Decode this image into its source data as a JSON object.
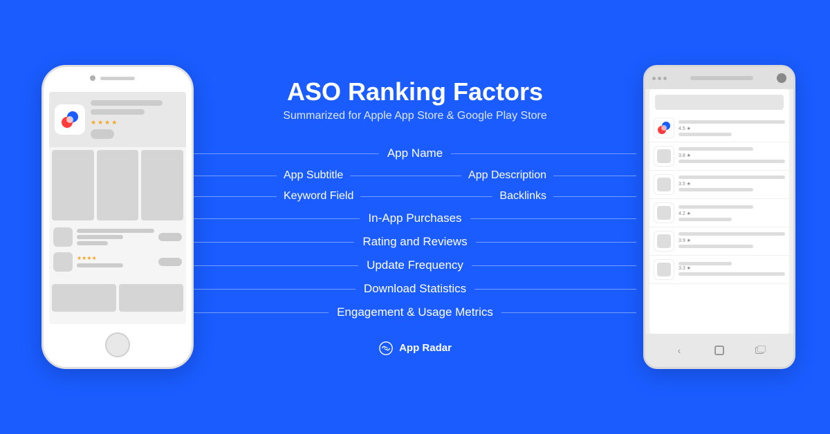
{
  "title": "ASO Ranking Factors",
  "subtitle": "Summarized for Apple App Store & Google Play Store",
  "factors": {
    "app_name": "App Name",
    "app_subtitle": "App Subtitle",
    "keyword_field": "Keyword Field",
    "app_description": "App Description",
    "backlinks": "Backlinks",
    "in_app_purchases": "In-App Purchases",
    "rating_reviews": "Rating and Reviews",
    "update_frequency": "Update Frequency",
    "download_statistics": "Download Statistics",
    "engagement_metrics": "Engagement & Usage Metrics"
  },
  "brand": {
    "name": "App Radar",
    "logo_title": "App Radar Logo"
  },
  "android_ratings": [
    {
      "rating": "4.5 ★"
    },
    {
      "rating": "3.8 ★"
    },
    {
      "rating": "3.5 ★"
    },
    {
      "rating": "4.2 ★"
    },
    {
      "rating": "3.9 ★"
    },
    {
      "rating": "3.3 ★"
    }
  ],
  "colors": {
    "background": "#1a5cff",
    "white": "#ffffff",
    "accent_blue": "#1a5cff"
  }
}
